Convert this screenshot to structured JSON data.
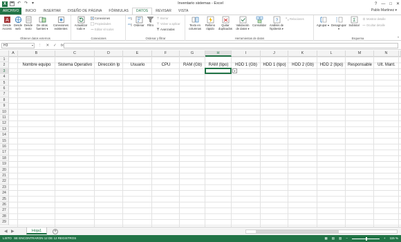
{
  "window": {
    "title": "Inventario sistemas - Excel",
    "app_icon_text": "X",
    "controls": [
      "?",
      "—",
      "□",
      "✕"
    ]
  },
  "ribbon_tabs": [
    {
      "label": "ARCHIVO"
    },
    {
      "label": "INICIO"
    },
    {
      "label": "INSERTAR"
    },
    {
      "label": "DISEÑO DE PÁGINA"
    },
    {
      "label": "FÓRMULAS"
    },
    {
      "label": "DATOS"
    },
    {
      "label": "REVISAR"
    },
    {
      "label": "VISTA"
    }
  ],
  "user": {
    "name": "Pablo Martinez ▾"
  },
  "ribbon": {
    "groups": {
      "external": "Obtener datos externos",
      "connections": "Conexiones",
      "sort_filter": "Ordenar y filtrar",
      "data_tools": "Herramientas de datos",
      "outline": "Esquema"
    },
    "buttons": {
      "desde_access": "Desde Access",
      "desde_web": "Desde web",
      "desde_texto": "Desde texto",
      "otras_fuentes": "De otras fuentes ▾",
      "conexiones_existentes": "Conexiones existentes",
      "actualizar_todo": "Actualizar todo ▾",
      "conexiones": "Conexiones",
      "propiedades": "Propiedades",
      "editar_vinculos": "Editar vínculos",
      "ordenar": "Ordenar",
      "filtro": "Filtro",
      "borrar": "Borrar",
      "volver_aplicar": "Volver a aplicar",
      "avanzadas": "Avanzadas",
      "texto_columnas": "Texto en columnas",
      "relleno_rapido": "Relleno rápido",
      "quitar_duplicados": "Quitar duplicados",
      "validacion": "Validación de datos ▾",
      "consolidar": "Consolidar",
      "analisis_hipotesis": "Análisis de hipótesis ▾",
      "relaciones": "Relaciones",
      "agrupar": "Agrupar ▾",
      "desagrupar": "Desagrupar ▾",
      "subtotal": "Subtotal",
      "mostrar_detalle": "Mostrar detalle",
      "ocultar_detalle": "Ocultar detalle"
    }
  },
  "formula_bar": {
    "name_box": "H3",
    "icons": [
      "⋮",
      "✕",
      "✓",
      "fx"
    ],
    "value": ""
  },
  "sheet": {
    "row_numbers": [
      "1",
      "2",
      "3",
      "4",
      "5",
      "6",
      "7",
      "8",
      "9",
      "10",
      "11",
      "12",
      "13",
      "14",
      "15",
      "16",
      "17",
      "18",
      "19",
      "20",
      "21",
      "22",
      "23",
      "24",
      "25",
      "26",
      "27",
      "28",
      "29"
    ],
    "columns": [
      {
        "letter": "A",
        "header": ""
      },
      {
        "letter": "B",
        "header": "Nombre equipo"
      },
      {
        "letter": "C",
        "header": "Sistema Operativo"
      },
      {
        "letter": "D",
        "header": "Dirección Ip"
      },
      {
        "letter": "E",
        "header": "Usuario"
      },
      {
        "letter": "F",
        "header": "CPU"
      },
      {
        "letter": "G",
        "header": "RAM (Gb)"
      },
      {
        "letter": "H",
        "header": "RAM (tipo)"
      },
      {
        "letter": "I",
        "header": "HDD 1 (Gb)"
      },
      {
        "letter": "J",
        "header": "HDD 1 (tipo)"
      },
      {
        "letter": "K",
        "header": "HDD 2 (Gb)"
      },
      {
        "letter": "L",
        "header": "HDD 2 (tipo)"
      },
      {
        "letter": "M",
        "header": "Responsable"
      },
      {
        "letter": "N",
        "header": "Ult. Mant."
      }
    ],
    "selected_cell": "H3"
  },
  "sheet_tabs": [
    {
      "label": "Hoja1"
    }
  ],
  "add_sheet": "+",
  "status": {
    "mode": "LISTO",
    "message": "SE ENCONTRARON 12 DE 12 REGISTROS",
    "zoom": "115 %"
  },
  "colors": {
    "accent": "#217346"
  }
}
